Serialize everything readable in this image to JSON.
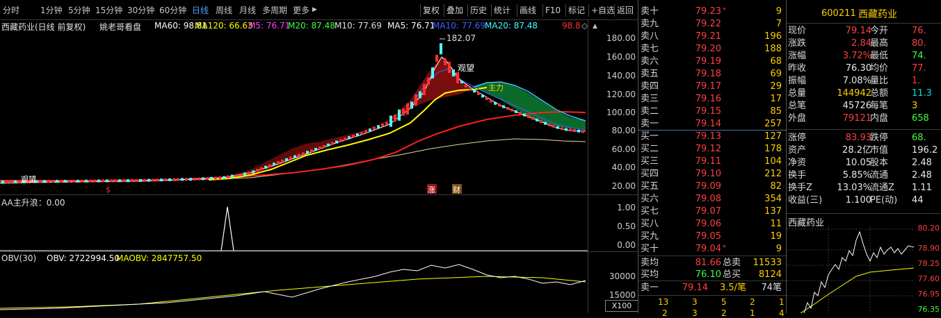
{
  "toolbar": {
    "periods": [
      "分时",
      "1分钟",
      "5分钟",
      "15分钟",
      "30分钟",
      "60分钟",
      "日线",
      "周线",
      "月线",
      "多周期",
      "更多"
    ],
    "more_arrow": "▶",
    "active_period": "日线",
    "buttons": [
      "复权",
      "叠加",
      "历史",
      "统计",
      "画线",
      "F10",
      "标记",
      "+自选",
      "返回"
    ]
  },
  "main_chart": {
    "title": "西藏药业(日线 前复权)",
    "indicator": "姚老哥看盘",
    "ma60": "MA60: 98.81",
    "ma120": "MA120: 66.63",
    "m5": "M5: 76.71",
    "m20": "M20: 87.48",
    "m10": "M10: 77.69",
    "ma5": "MA5: 76.71",
    "ma10": "MA10: 77.69",
    "ma20": "MA20: 87.48",
    "corner_value": "98.8",
    "high_label": "182.07",
    "annotations": [
      "观望",
      "观望",
      "主力",
      "涨",
      "财"
    ],
    "y_ticks": [
      "180.00",
      "160.00",
      "140.00",
      "120.00",
      "100.00",
      "80.00",
      "60.00",
      "40.00",
      "20.00"
    ]
  },
  "sub1": {
    "title": "AA主升浪：0.00",
    "y_ticks": [
      "1.00",
      "0.50",
      "0.00"
    ]
  },
  "sub2": {
    "title": "OBV(30)",
    "obv": "OBV: 2722994.50",
    "maobv": "MAOBV: 2847757.50",
    "y_ticks": [
      "30000",
      "15000"
    ],
    "unit": "X100"
  },
  "book": {
    "sell": [
      {
        "label": "卖十",
        "price": "79.23",
        "tag": "*",
        "vol": "9"
      },
      {
        "label": "卖九",
        "price": "79.22",
        "tag": "",
        "vol": "7"
      },
      {
        "label": "卖八",
        "price": "79.21",
        "tag": "",
        "vol": "196"
      },
      {
        "label": "卖七",
        "price": "79.20",
        "tag": "",
        "vol": "188"
      },
      {
        "label": "卖六",
        "price": "79.19",
        "tag": "",
        "vol": "68"
      },
      {
        "label": "卖五",
        "price": "79.18",
        "tag": "",
        "vol": "69"
      },
      {
        "label": "卖四",
        "price": "79.17",
        "tag": "",
        "vol": "29"
      },
      {
        "label": "卖三",
        "price": "79.16",
        "tag": "",
        "vol": "17"
      },
      {
        "label": "卖二",
        "price": "79.15",
        "tag": "",
        "vol": "85"
      },
      {
        "label": "卖一",
        "price": "79.14",
        "tag": "",
        "vol": "257"
      }
    ],
    "buy": [
      {
        "label": "买一",
        "price": "79.13",
        "tag": "",
        "vol": "127"
      },
      {
        "label": "买二",
        "price": "79.12",
        "tag": "",
        "vol": "178"
      },
      {
        "label": "买三",
        "price": "79.11",
        "tag": "",
        "vol": "104"
      },
      {
        "label": "买四",
        "price": "79.10",
        "tag": "",
        "vol": "212"
      },
      {
        "label": "买五",
        "price": "79.09",
        "tag": "",
        "vol": "82"
      },
      {
        "label": "买六",
        "price": "79.08",
        "tag": "",
        "vol": "354"
      },
      {
        "label": "买七",
        "price": "79.07",
        "tag": "",
        "vol": "137"
      },
      {
        "label": "买八",
        "price": "79.06",
        "tag": "",
        "vol": "11"
      },
      {
        "label": "买九",
        "price": "79.05",
        "tag": "",
        "vol": "19"
      },
      {
        "label": "买十",
        "price": "79.04",
        "tag": "*",
        "vol": "9"
      }
    ],
    "avg_sell_label": "卖均",
    "avg_sell": "81.66",
    "total_sell_label": "总卖",
    "total_sell": "11533",
    "avg_buy_label": "买均",
    "avg_buy": "76.10",
    "total_buy_label": "总买",
    "total_buy": "8124",
    "last_label": "卖一",
    "last_price": "79.14",
    "last_rate": "3.5/笔",
    "last_count": "74笔",
    "queue1": [
      "13",
      "3",
      "5",
      "2",
      "1"
    ],
    "queue2": [
      "2",
      "3",
      "2",
      "1",
      "4"
    ]
  },
  "quote": {
    "code": "600211",
    "name": "西藏药业",
    "rows": [
      {
        "l1": "现价",
        "v1": "79.14",
        "c1": "red",
        "l2": "今开",
        "v2": "76.",
        "c2": "red"
      },
      {
        "l1": "涨跌",
        "v1": "2.84",
        "c1": "red",
        "l2": "最高",
        "v2": "80.",
        "c2": "red"
      },
      {
        "l1": "涨幅",
        "v1": "3.72%",
        "c1": "red",
        "l2": "最低",
        "v2": "74.",
        "c2": "green"
      },
      {
        "l1": "昨收",
        "v1": "76.30",
        "c1": "white",
        "l2": "均价",
        "v2": "77.",
        "c2": "red"
      },
      {
        "l1": "振幅",
        "v1": "7.08%",
        "c1": "white",
        "l2": "量比",
        "v2": "1.",
        "c2": "red"
      },
      {
        "l1": "总量",
        "v1": "144942",
        "c1": "yellow",
        "l2": "总额",
        "v2": "11.3",
        "c2": "cyan"
      },
      {
        "l1": "总笔",
        "v1": "45726",
        "c1": "white",
        "l2": "每笔",
        "v2": "3",
        "c2": "yellow"
      },
      {
        "l1": "外盘",
        "v1": "79121",
        "c1": "red",
        "l2": "内盘",
        "v2": "658",
        "c2": "green"
      },
      {
        "l1": "涨停",
        "v1": "83.93",
        "c1": "red",
        "l2": "跌停",
        "v2": "68.",
        "c2": "green"
      },
      {
        "l1": "资产",
        "v1": "28.2亿",
        "c1": "white",
        "l2": "市值",
        "v2": "196.2",
        "c2": "white"
      },
      {
        "l1": "净资",
        "v1": "10.05",
        "c1": "white",
        "l2": "股本",
        "v2": "2.48",
        "c2": "white"
      },
      {
        "l1": "换手",
        "v1": "5.85%",
        "c1": "white",
        "l2": "流通",
        "v2": "2.48",
        "c2": "white"
      },
      {
        "l1": "换手Z",
        "v1": "13.03%",
        "c1": "white",
        "l2": "流通Z",
        "v2": "1.11",
        "c2": "white"
      },
      {
        "l1": "收益(三)",
        "v1": "1.100",
        "c1": "white",
        "l2": "PE(动)",
        "v2": "44",
        "c2": "white"
      }
    ],
    "mini_title": "西藏药业",
    "mini_ticks": [
      "80.20",
      "78.90",
      "78.25",
      "77.60",
      "76.95",
      "76.35"
    ]
  },
  "colors": {
    "up": "#ff3030",
    "down": "#54ffff",
    "ma_yellow": "#ffff00",
    "ma_red": "#ff2020",
    "ma_white": "#ffffff"
  }
}
